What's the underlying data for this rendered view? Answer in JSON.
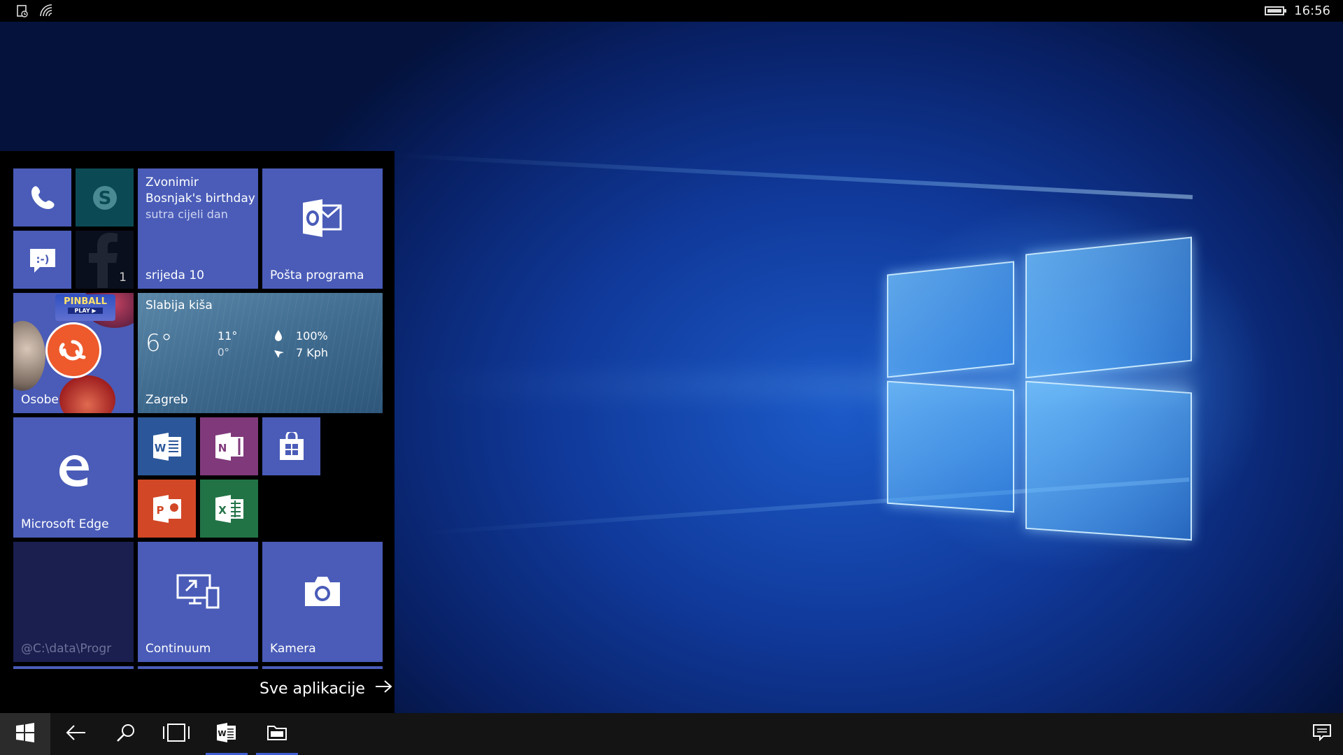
{
  "status_bar": {
    "time": "16:56",
    "icons": [
      "phone-status-icon",
      "wifi-icon"
    ],
    "battery_level": 1.0
  },
  "start": {
    "tiles": {
      "phone": {
        "icon": "phone-icon"
      },
      "skype": {
        "icon": "skype-icon"
      },
      "messaging": {
        "icon": "messaging-icon"
      },
      "facebook": {
        "icon": "facebook-icon",
        "badge": "1"
      },
      "calendar": {
        "event_title": "Zvonimir Bosnjak's birthday",
        "event_time": "sutra cijeli dan",
        "date": "srijeda 10"
      },
      "outlook": {
        "label": "Pošta programa",
        "icon": "outlook-icon"
      },
      "people": {
        "label": "Osobe",
        "icon": "people-hub-icon",
        "banner": "PINBALL",
        "banner_sub": "PLAY ▶"
      },
      "weather": {
        "condition": "Slabija kiša",
        "temp": "6°",
        "high": "11°",
        "low": "0°",
        "humidity": "100%",
        "wind": "7 Kph",
        "city": "Zagreb"
      },
      "edge": {
        "label": "Microsoft Edge",
        "icon": "edge-icon"
      },
      "word": {
        "icon": "word-icon",
        "color": "#2b579a"
      },
      "onenote": {
        "icon": "onenote-icon",
        "color": "#80397b"
      },
      "store": {
        "icon": "store-icon"
      },
      "powerpoint": {
        "icon": "powerpoint-icon",
        "color": "#d24726"
      },
      "excel": {
        "icon": "excel-icon",
        "color": "#217346"
      },
      "placeholder": {
        "label": "@C:\\data\\Progr"
      },
      "continuum": {
        "label": "Continuum",
        "icon": "continuum-icon"
      },
      "camera": {
        "label": "Kamera",
        "icon": "camera-icon"
      }
    },
    "all_apps_label": "Sve aplikacije"
  },
  "taskbar": {
    "items": [
      "start-icon",
      "back-icon",
      "search-icon",
      "task-view-icon",
      "word-icon",
      "file-explorer-icon",
      "action-center-icon"
    ]
  },
  "colors": {
    "tile_blue": "#4a5cb8",
    "accent": "#3f5fd6",
    "taskbar": "#141414"
  }
}
